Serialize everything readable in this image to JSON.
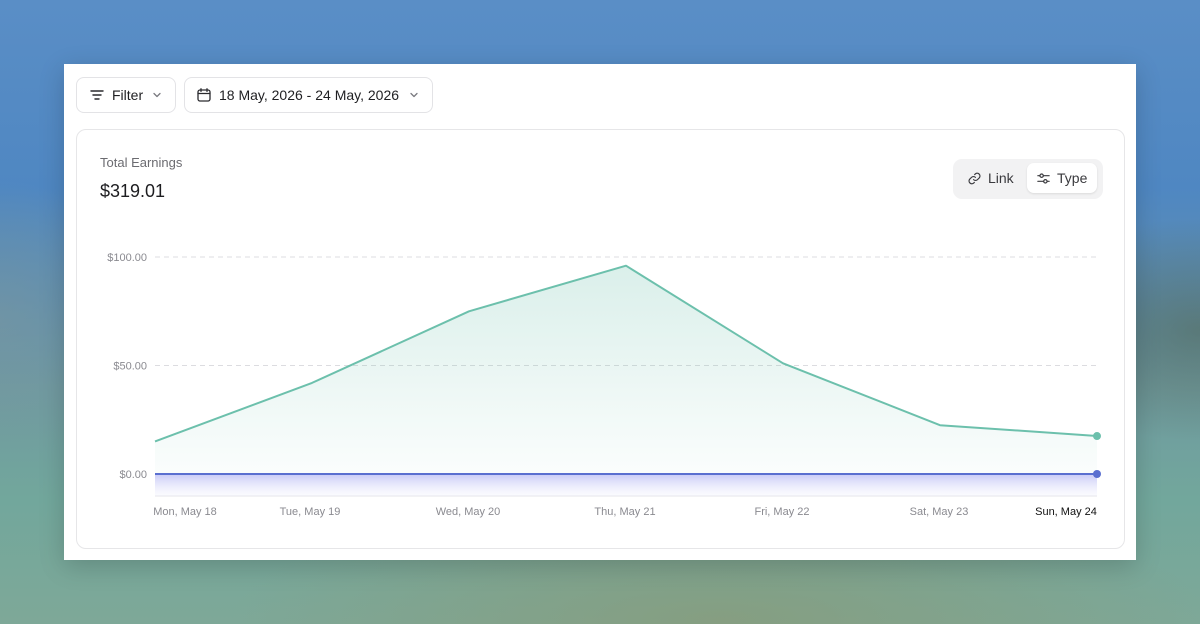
{
  "toolbar": {
    "filter_label": "Filter",
    "date_range_label": "18 May, 2026 - 24 May, 2026"
  },
  "card": {
    "title": "Total Earnings",
    "total": "$319.01"
  },
  "view_toggle": {
    "options": [
      {
        "label": "Link",
        "icon": "link-icon",
        "selected": false
      },
      {
        "label": "Type",
        "icon": "sliders-icon",
        "selected": true
      }
    ]
  },
  "colors": {
    "earnings_line": "#6cc0ac",
    "zero_line": "#5a6fd0"
  },
  "chart_data": {
    "type": "area",
    "categories": [
      "Mon, May 18",
      "Tue, May 19",
      "Wed, May 20",
      "Thu, May 21",
      "Fri, May 22",
      "Sat, May 23",
      "Sun, May 24"
    ],
    "y_tick_labels": [
      "$0.00",
      "$50.00",
      "$100.00"
    ],
    "y_ticks": [
      0,
      50,
      100
    ],
    "ylim": [
      -10,
      100
    ],
    "grid": "horizontal dashed",
    "highlighted_category": "Sun, May 24",
    "series": [
      {
        "values": [
          15,
          42,
          75,
          96,
          51,
          22.5,
          17.5
        ],
        "color": "#6cc0ac"
      },
      {
        "values": [
          0,
          0,
          0,
          0,
          0,
          0,
          0
        ],
        "color": "#5a6fd0"
      }
    ]
  }
}
